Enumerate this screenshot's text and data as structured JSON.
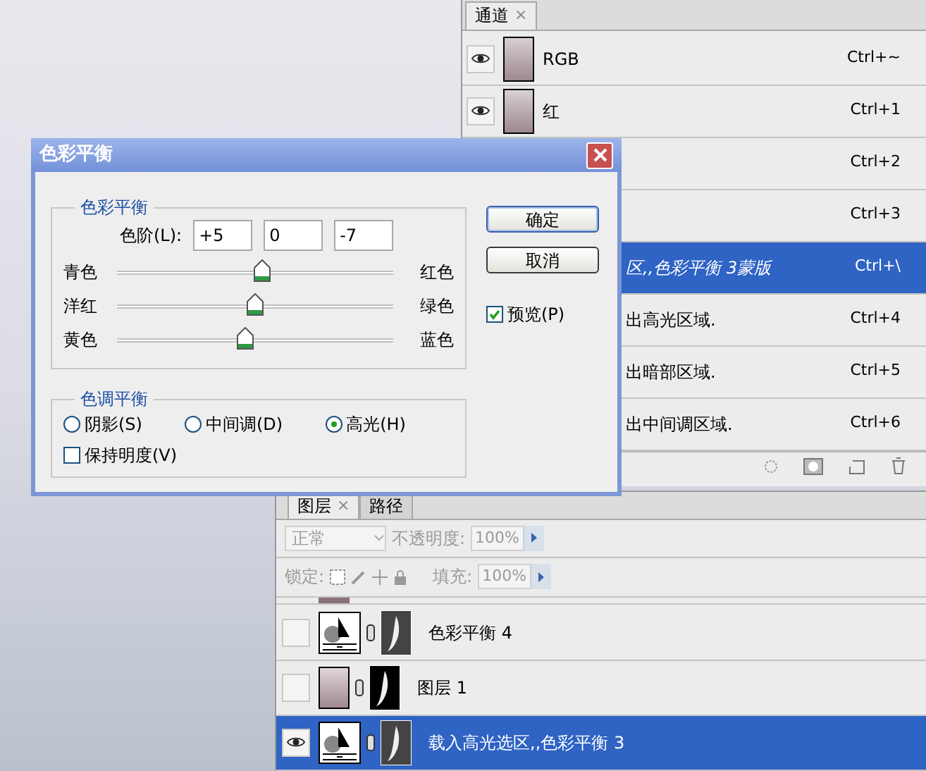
{
  "channels_panel": {
    "tab": {
      "label": "通道",
      "close": "×"
    },
    "rows": [
      {
        "kind": "full",
        "name": "RGB",
        "shortcut": "Ctrl+~",
        "visible": true,
        "selected": false
      },
      {
        "kind": "full",
        "name": "红",
        "shortcut": "Ctrl+1",
        "visible": true,
        "selected": false
      },
      {
        "kind": "clipped",
        "shortcut": "Ctrl+2",
        "selected": false
      },
      {
        "kind": "clipped",
        "shortcut": "Ctrl+3",
        "selected": false
      },
      {
        "kind": "clipped",
        "name": "区,,色彩平衡 3蒙版",
        "shortcut": "Ctrl+\\",
        "selected": true
      },
      {
        "kind": "clipped",
        "name": "出高光区域.",
        "shortcut": "Ctrl+4",
        "selected": false
      },
      {
        "kind": "clipped",
        "name": "出暗部区域.",
        "shortcut": "Ctrl+5",
        "selected": false
      },
      {
        "kind": "clipped",
        "name": "出中间调区域.",
        "shortcut": "Ctrl+6",
        "selected": false
      }
    ]
  },
  "dialog": {
    "title": "色彩平衡",
    "color_balance": {
      "legend": "色彩平衡",
      "levels_label": "色阶(L):",
      "values": [
        "+5",
        "0",
        "-7"
      ],
      "sliders": [
        {
          "left": "青色",
          "right": "红色",
          "level": 0.525
        },
        {
          "left": "洋红",
          "right": "绿色",
          "level": 0.5
        },
        {
          "left": "黄色",
          "right": "蓝色",
          "level": 0.465
        }
      ]
    },
    "tone_balance": {
      "legend": "色调平衡",
      "options": [
        {
          "label": "阴影(S)",
          "selected": false
        },
        {
          "label": "中间调(D)",
          "selected": false
        },
        {
          "label": "高光(H)",
          "selected": true
        }
      ],
      "preserve": {
        "label": "保持明度(V)",
        "checked": false
      }
    },
    "buttons": [
      "确定",
      "取消"
    ],
    "preview": {
      "label": "预览(P)",
      "checked": true
    }
  },
  "layers_panel": {
    "tabs": [
      {
        "label": "图层",
        "close": "×",
        "selected": true
      },
      {
        "label": "路径",
        "selected": false
      }
    ],
    "blend_mode": "正常",
    "opacity_label": "不透明度:",
    "opacity": "100%",
    "lock_label": "锁定:",
    "fill_label": "填充:",
    "fill": "100%",
    "layers": [
      {
        "kind": "adjustment",
        "name": "色彩平衡 4",
        "visible": false,
        "selected": false
      },
      {
        "kind": "pixel",
        "name": "图层 1",
        "visible": false,
        "selected": false
      },
      {
        "kind": "adjustment",
        "name": "载入高光选区,,色彩平衡 3",
        "visible": true,
        "selected": true
      }
    ]
  }
}
